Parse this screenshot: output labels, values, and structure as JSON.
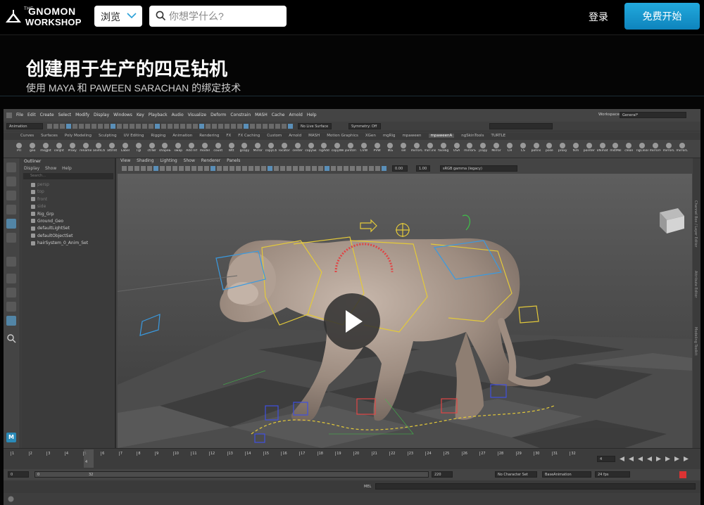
{
  "brand": {
    "small": "THE",
    "line1": "GNOMON",
    "line2": "WORKSHOP"
  },
  "nav": {
    "browse_label": "浏览",
    "search_placeholder": "你想学什么?",
    "login_label": "登录",
    "cta_label": "免费开始"
  },
  "hero": {
    "title": "创建用于生产的四足钻机",
    "subtitle": "使用 MAYA 和 PAWEEN SARACHAN 的绑定技术"
  },
  "maya": {
    "main_menu": [
      "File",
      "Edit",
      "Create",
      "Select",
      "Modify",
      "Display",
      "Windows",
      "Key",
      "Playback",
      "Audio",
      "Visualize",
      "Deform",
      "Constrain",
      "MASH",
      "Cache",
      "Arnold",
      "Help"
    ],
    "workspace_label": "Workspace:",
    "workspace_value": "General*",
    "menuset": "Animation",
    "live_surface": "No Live Surface",
    "symmetry": "Symmetry: Off",
    "shelf_tabs": [
      "Curves",
      "Surfaces",
      "Poly Modeling",
      "Sculpting",
      "UV Editing",
      "Rigging",
      "Animation",
      "Rendering",
      "FX",
      "FX Caching",
      "Custom",
      "Arnold",
      "MASH",
      "Motion Graphics",
      "XGen",
      "mgRig",
      "mpaween",
      "mpaweenA",
      "ngSkinTools",
      "TURTLE"
    ],
    "active_shelf_tab": "mpaweenA",
    "shelf_labels": [
      "PIT",
      "geo",
      "msgJnt",
      "cenJnt",
      "Proxy",
      "rename",
      "animCtrl",
      "attrInt",
      "Label",
      "Tgl",
      "ctrlBr",
      "shapeEdit",
      "swap",
      "Add Inf",
      "model",
      "count",
      "Wtt",
      "gcopy",
      "Mirror",
      "copyCtrl",
      "locator",
      "center",
      "copySk",
      "rigAdd",
      "copyWei",
      "jointOri",
      "CVW",
      "PVW",
      "IKG",
      "sel",
      "mirrorC",
      "mirr.ins",
      "facelig",
      "USA",
      "mirrorS",
      "jcopy",
      "Mirror",
      "CH",
      "CS",
      "pohns",
      "pose",
      "proxy",
      "fkm",
      "pointer",
      "ofkmat",
      "mstMkl",
      "clean",
      "rigClean",
      "mirrorF",
      "mirrorL",
      "mirrorL"
    ],
    "outliner": {
      "title": "Outliner",
      "menu": [
        "Display",
        "Show",
        "Help"
      ],
      "search": "Search...",
      "items": [
        {
          "label": "persp",
          "dim": true
        },
        {
          "label": "top",
          "dim": true
        },
        {
          "label": "front",
          "dim": true
        },
        {
          "label": "side",
          "dim": true
        },
        {
          "label": "Rig_Grp",
          "dim": false
        },
        {
          "label": "Ground_Geo",
          "dim": false
        },
        {
          "label": "defaultLightSet",
          "dim": false
        },
        {
          "label": "defaultObjectSet",
          "dim": false
        },
        {
          "label": "hairSystem_0_Anim_Set",
          "dim": false
        }
      ]
    },
    "panel_menu": [
      "View",
      "Shading",
      "Lighting",
      "Show",
      "Renderer",
      "Panels"
    ],
    "panel_values": {
      "a": "0.00",
      "b": "1.00",
      "colorspace": "sRGB gamma (legacy)"
    },
    "right_strip_labels": [
      "Channel Box / Layer Editor",
      "Attribute Editor",
      "Modeling Toolkit"
    ],
    "timeline": {
      "ticks": [
        "1",
        "2",
        "3",
        "4",
        "5",
        "6",
        "7",
        "8",
        "9",
        "10",
        "11",
        "12",
        "13",
        "14",
        "15",
        "16",
        "17",
        "18",
        "19",
        "20",
        "21",
        "22",
        "23",
        "24",
        "25",
        "26",
        "27",
        "28",
        "29",
        "30",
        "31",
        "32"
      ],
      "current_frame": "4",
      "current_frame_field": "4"
    },
    "range": {
      "start": "0",
      "inner_start": "0",
      "inner_end": "32",
      "end": "220",
      "character_set": "No Character Set",
      "anim_layer": "BaseAnimation",
      "fps": "24 fps"
    },
    "cmd_label": "MEL"
  }
}
